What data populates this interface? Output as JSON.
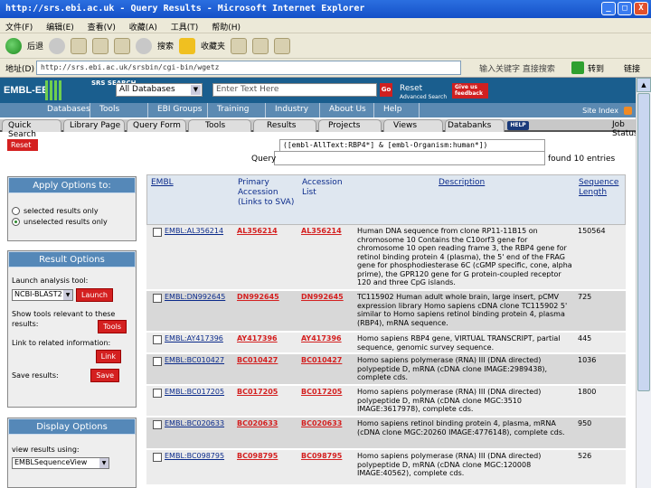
{
  "window": {
    "title": "http://srs.ebi.ac.uk - Query Results - Microsoft Internet Explorer",
    "buttons": [
      "_",
      "□",
      "X"
    ]
  },
  "menubar": [
    "文件(F)",
    "编辑(E)",
    "查看(V)",
    "收藏(A)",
    "工具(T)",
    "帮助(H)"
  ],
  "toolbar": {
    "back": "后退",
    "search": "搜索",
    "favorites": "收藏夹"
  },
  "address": {
    "label": "地址(D)",
    "url": "http://srs.ebi.ac.uk/srsbin/cgi-bin/wgetz",
    "right_hint": "输入关键字 直接搜索",
    "go": "转到",
    "links": "链接"
  },
  "ebi": {
    "logo": "EMBL-EBI",
    "srs_search": "SRS SEARCH",
    "database_select": "All Databases",
    "query_placeholder": "Enter Text Here",
    "go": "Go",
    "reset": "Reset",
    "advanced": "Advanced Search",
    "feedback": "Give us feedback"
  },
  "nav_primary": [
    "Databases",
    "Tools",
    "EBI Groups",
    "Training",
    "Industry",
    "About Us",
    "Help"
  ],
  "site_index": "Site Index",
  "nav_secondary": [
    "Quick Search",
    "Library Page",
    "Query Form",
    "Tools",
    "Results",
    "Projects",
    "Views",
    "Databanks"
  ],
  "help_badge": "HELP",
  "job_status": "Job Status",
  "query": {
    "reset_button": "Reset",
    "text": "([embl-AllText:RBP4*] & [embl-Organism:human*])",
    "label": "Query",
    "found": "found 10 entries"
  },
  "apply_panel": {
    "title": "Apply Options to:",
    "opt1": "selected results only",
    "opt2": "unselected results only"
  },
  "result_panel": {
    "title": "Result Options",
    "launch_label": "Launch analysis tool:",
    "tool": "NCBI-BLAST2",
    "launch_btn": "Launch",
    "show_tools_label": "Show tools relevant to these results:",
    "tools_btn": "Tools",
    "link_label": "Link to related information:",
    "link_btn": "Link",
    "save_label": "Save results:",
    "save_btn": "Save"
  },
  "display_panel": {
    "title": "Display Options",
    "view_label": "view results using:",
    "view_value": "EMBLSequenceView"
  },
  "table": {
    "headers": {
      "embl": "EMBL",
      "primary": "Primary Accession (Links to SVA)",
      "accession": "Accession List",
      "description": "Description",
      "seqlen": "Sequence Length"
    },
    "rows": [
      {
        "id": "EMBL:AL356214",
        "primary": "AL356214",
        "acc": "AL356214",
        "desc": "Human DNA sequence from clone RP11-11B15 on chromosome 10 Contains the C10orf3 gene for chromosome 10 open reading frame 3, the RBP4 gene for retinol binding protein 4 (plasma), the 5' end of the FRAG gene for phosphodiesterase 6C (cGMP specific, cone, alpha prime), the GPR120 gene for G protein-coupled receptor 120 and three CpG islands.",
        "len": "150564"
      },
      {
        "id": "EMBL:DN992645",
        "primary": "DN992645",
        "acc": "DN992645",
        "desc": "TC115902 Human adult whole brain, large insert, pCMV expression library Homo sapiens cDNA clone TC115902 5' similar to Homo sapiens retinol binding protein 4, plasma (RBP4), mRNA sequence.",
        "len": "725"
      },
      {
        "id": "EMBL:AY417396",
        "primary": "AY417396",
        "acc": "AY417396",
        "desc": "Homo sapiens RBP4 gene, VIRTUAL TRANSCRIPT, partial sequence, genomic survey sequence.",
        "len": "445"
      },
      {
        "id": "EMBL:BC010427",
        "primary": "BC010427",
        "acc": "BC010427",
        "desc": "Homo sapiens polymerase (RNA) III (DNA directed) polypeptide D, mRNA (cDNA clone IMAGE:2989438), complete cds.",
        "len": "1036"
      },
      {
        "id": "EMBL:BC017205",
        "primary": "BC017205",
        "acc": "BC017205",
        "desc": "Homo sapiens polymerase (RNA) III (DNA directed) polypeptide D, mRNA (cDNA clone MGC:3510 IMAGE:3617978), complete cds.",
        "len": "1800"
      },
      {
        "id": "EMBL:BC020633",
        "primary": "BC020633",
        "acc": "BC020633",
        "desc": "Homo sapiens retinol binding protein 4, plasma, mRNA (cDNA clone MGC:20260 IMAGE:4776148), complete cds.",
        "len": "950"
      },
      {
        "id": "EMBL:BC098795",
        "primary": "BC098795",
        "acc": "BC098795",
        "desc": "Homo sapiens polymerase (RNA) III (DNA directed) polypeptide D, mRNA (cDNA clone MGC:120008 IMAGE:40562), complete cds.",
        "len": "526"
      }
    ]
  }
}
